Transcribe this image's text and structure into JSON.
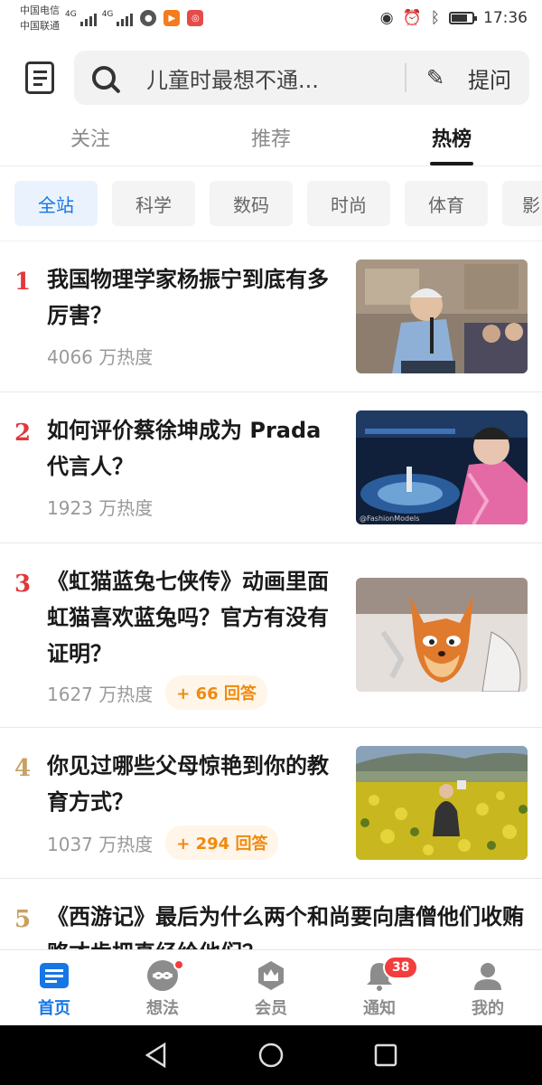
{
  "status_bar": {
    "carrier1": "中国电信",
    "carrier2": "中国联通",
    "net1": "4G",
    "net2": "4G",
    "time": "17:36",
    "battery_level": 0.75
  },
  "header": {
    "search_query": "儿童时最想不通...",
    "ask_label": "提问"
  },
  "tabs": [
    {
      "label": "关注",
      "active": false
    },
    {
      "label": "推荐",
      "active": false
    },
    {
      "label": "热榜",
      "active": true
    }
  ],
  "categories": [
    {
      "label": "全站",
      "active": true
    },
    {
      "label": "科学",
      "active": false
    },
    {
      "label": "数码",
      "active": false
    },
    {
      "label": "时尚",
      "active": false
    },
    {
      "label": "体育",
      "active": false
    },
    {
      "label": "影",
      "active": false
    }
  ],
  "hot_list": [
    {
      "rank": "1",
      "title": "我国物理学家杨振宁到底有多厉害？",
      "heat": "4066 万热度",
      "answers": "",
      "rank_color": "#e2383b"
    },
    {
      "rank": "2",
      "title": "如何评价蔡徐坤成为 Prada 代言人？",
      "heat": "1923 万热度",
      "answers": "",
      "rank_color": "#e2383b"
    },
    {
      "rank": "3",
      "title": "《虹猫蓝兔七侠传》动画里面虹猫喜欢蓝兔吗？官方有没有证明？",
      "heat": "1627 万热度",
      "answers": "+ 66 回答",
      "rank_color": "#e2383b"
    },
    {
      "rank": "4",
      "title": "你见过哪些父母惊艳到你的教育方式？",
      "heat": "1037 万热度",
      "answers": "+ 294 回答",
      "rank_color": "#c9a063"
    },
    {
      "rank": "5",
      "title": "《西游记》最后为什么两个和尚要向唐僧他们收贿赂才肯把真经给他们？",
      "heat": "",
      "answers": "",
      "rank_color": "#c9a063"
    }
  ],
  "thumb_caption": "@FashionModels",
  "bottom_nav": [
    {
      "label": "首页",
      "icon": "home-icon",
      "active": true,
      "badge": ""
    },
    {
      "label": "想法",
      "icon": "ideas-icon",
      "active": false,
      "badge": "dot"
    },
    {
      "label": "会员",
      "icon": "crown-icon",
      "active": false,
      "badge": ""
    },
    {
      "label": "通知",
      "icon": "bell-icon",
      "active": false,
      "badge": "38"
    },
    {
      "label": "我的",
      "icon": "profile-icon",
      "active": false,
      "badge": ""
    }
  ],
  "colors": {
    "accent": "#1776e6",
    "hot_red": "#e2383b",
    "rank_gold": "#c9a063",
    "answers_orange": "#f08a0e"
  }
}
